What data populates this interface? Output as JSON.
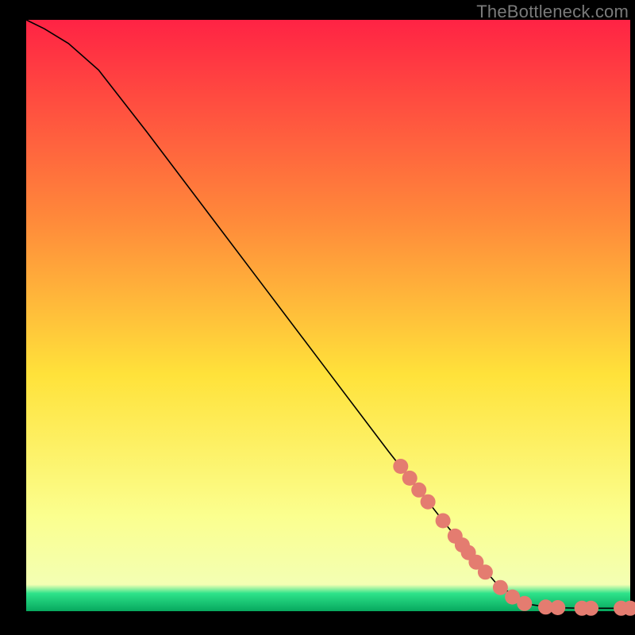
{
  "watermark": "TheBottleneck.com",
  "colors": {
    "marker_fill": "#e47c70",
    "marker_stroke": "#cc6b60",
    "curve": "#000000",
    "gradient_top": "#ff2344",
    "gradient_mid1": "#ff8a3a",
    "gradient_mid2": "#ffe23a",
    "gradient_mid3": "#fbff8f",
    "gradient_band": "#2de28a",
    "gradient_bottom": "#07a85e"
  },
  "chart_data": {
    "type": "line",
    "title": "",
    "xlabel": "",
    "ylabel": "",
    "xlim": [
      0,
      100
    ],
    "ylim": [
      0,
      100
    ],
    "curve": [
      {
        "x": 0,
        "y": 100
      },
      {
        "x": 3,
        "y": 98.5
      },
      {
        "x": 7,
        "y": 96
      },
      {
        "x": 12,
        "y": 91.5
      },
      {
        "x": 20,
        "y": 81
      },
      {
        "x": 30,
        "y": 67.5
      },
      {
        "x": 40,
        "y": 54
      },
      {
        "x": 50,
        "y": 40.5
      },
      {
        "x": 60,
        "y": 27
      },
      {
        "x": 70,
        "y": 14
      },
      {
        "x": 78,
        "y": 4.5
      },
      {
        "x": 83,
        "y": 1.2
      },
      {
        "x": 87,
        "y": 0.6
      },
      {
        "x": 92,
        "y": 0.5
      },
      {
        "x": 100,
        "y": 0.5
      }
    ],
    "markers": [
      {
        "x": 62.0,
        "y": 24.5
      },
      {
        "x": 63.5,
        "y": 22.5
      },
      {
        "x": 65.0,
        "y": 20.5
      },
      {
        "x": 66.5,
        "y": 18.5
      },
      {
        "x": 69.0,
        "y": 15.3
      },
      {
        "x": 71.0,
        "y": 12.7
      },
      {
        "x": 72.2,
        "y": 11.2
      },
      {
        "x": 73.2,
        "y": 9.9
      },
      {
        "x": 74.5,
        "y": 8.3
      },
      {
        "x": 76.0,
        "y": 6.6
      },
      {
        "x": 78.5,
        "y": 4.0
      },
      {
        "x": 80.5,
        "y": 2.4
      },
      {
        "x": 82.5,
        "y": 1.3
      },
      {
        "x": 86.0,
        "y": 0.7
      },
      {
        "x": 88.0,
        "y": 0.6
      },
      {
        "x": 92.0,
        "y": 0.5
      },
      {
        "x": 93.5,
        "y": 0.5
      },
      {
        "x": 98.5,
        "y": 0.5
      },
      {
        "x": 100.0,
        "y": 0.5
      }
    ],
    "marker_radius_px": 9.5
  }
}
